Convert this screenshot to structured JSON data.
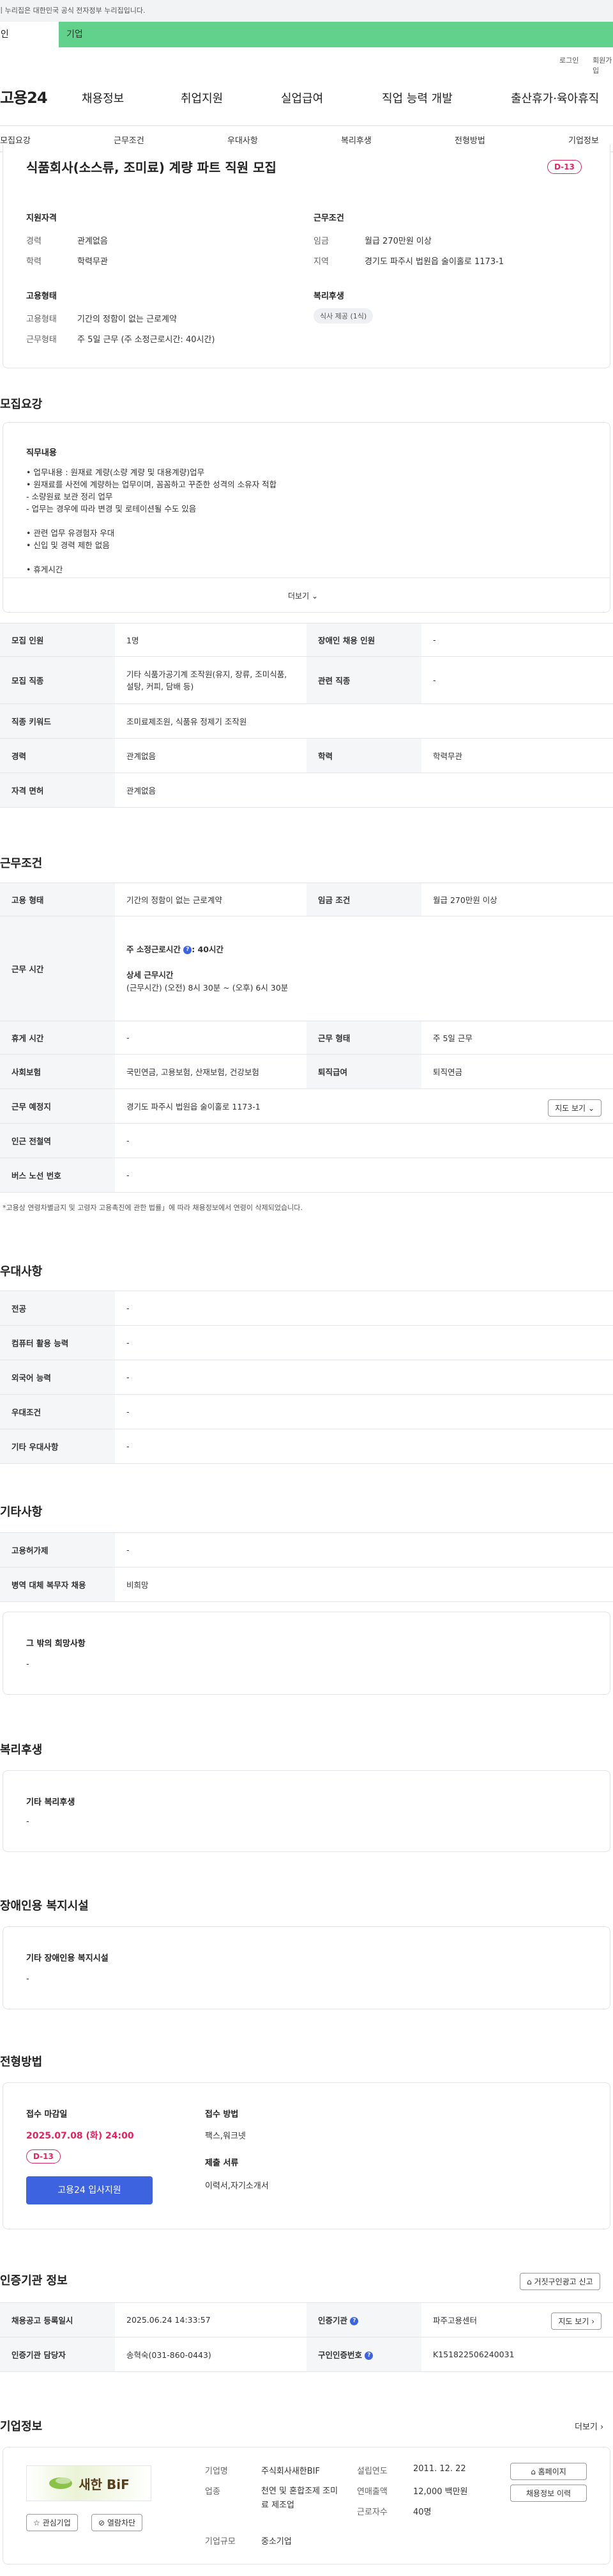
{
  "gov_banner": "이 누리집은 대한민국 공식 전자정부 누리집입니다.",
  "tabs": [
    "개인",
    "기업"
  ],
  "util_links": [
    "로그인",
    "회원가입"
  ],
  "brand": "고용24",
  "gnb": [
    "채용정보",
    "취업지원",
    "실업급여",
    "직업 능력 개발",
    "출산휴가·육아휴직"
  ],
  "subnav": [
    "모집요강",
    "근무조건",
    "우대사항",
    "복리후생",
    "전형방법",
    "기업정보"
  ],
  "job": {
    "title": "식품회사(소스류, 조미료) 계량 파트 직원 모집",
    "dday": "D-13",
    "qualification_h": "지원자격",
    "career_l": "경력",
    "career_v": "관계없음",
    "edu_l": "학력",
    "edu_v": "학력무관",
    "conditions_h": "근무조건",
    "wage_l": "임금",
    "wage_v": "월급 270만원 이상",
    "region_l": "지역",
    "region_v": "경기도 파주시 법원읍 술이홀로 1173-1",
    "employ_h": "고용형태",
    "emptype_l": "고용형태",
    "emptype_v": "기간의 정함이 없는 근로계약",
    "worktype_l": "근무형태",
    "worktype_v": "주 5일 근무 (주 소정근로시간: 40시간)",
    "welfare_h": "복리후생",
    "welfare_pill": "식사 제공 (1식)"
  },
  "recruit": {
    "title": "모집요강",
    "duty_h": "직무내용",
    "duty_lines": [
      "• 업무내용 : 원재료 계량(소량 계량 및 대용계량)업무",
      "• 원재료를 사전에 계량하는 업무이며, 꼼꼼하고 꾸준한 성격의 소유자 적합",
      "- 소량원료 보관 정리 업무",
      "- 업무는 경우에 따라 변경 및 로테이션될 수도 있음",
      "",
      "• 관련 업무 유경험자 우대",
      "• 신입 및 경력 제한 없음",
      "",
      "• 휴게시간"
    ],
    "more": "더보기",
    "rows": [
      [
        "모집 인원",
        "1명",
        "장애인 채용 인원",
        "-"
      ],
      [
        "모집 직종",
        "기타 식품가공기계 조작원(유지, 장류, 조미식품, 설탕, 커피, 담배 등)",
        "관련 직종",
        "-"
      ],
      [
        "직종 키워드",
        "조미료제조원, 식품유 정제기 조작원",
        "",
        ""
      ],
      [
        "경력",
        "관계없음",
        "학력",
        "학력무관"
      ],
      [
        "자격 면허",
        "관계없음",
        "",
        ""
      ]
    ]
  },
  "conditions": {
    "title": "근무조건",
    "emptype_l": "고용 형태",
    "emptype_v": "기간의 정함이 없는 근로계약",
    "wage_l": "임금 조건",
    "wage_v": "월급 270만원 이상",
    "hours_l": "근무 시간",
    "hours_week_l": "주 소정근로시간",
    "hours_week_v": ": 40시간",
    "hours_detail_l": "상세 근무시간",
    "hours_detail_v": "(근무시간) (오전) 8시 30분 ~ (오후) 6시 30분",
    "rest_l": "휴게 시간",
    "rest_v": "-",
    "worktype_l": "근무 형태",
    "worktype_v": "주 5일 근무",
    "insurance_l": "사회보험",
    "insurance_v": "국민연금, 고용보험, 산재보험, 건강보험",
    "retire_l": "퇴직급여",
    "retire_v": "퇴직연금",
    "place_l": "근무 예정지",
    "place_v": "경기도 파주시 법원읍 술이홀로 1173-1",
    "map_btn": "지도 보기",
    "subway_l": "인근 전철역",
    "subway_v": "-",
    "bus_l": "버스 노선 번호",
    "bus_v": "-",
    "note": "*고용상 연령차별금지 및 고령자 고용촉진에 관한 법률」에 따라 채용정보에서 연령이 삭제되었습니다."
  },
  "preference": {
    "title": "우대사항",
    "rows": [
      [
        "전공",
        "-"
      ],
      [
        "컴퓨터 활용 능력",
        "-"
      ],
      [
        "외국어 능력",
        "-"
      ],
      [
        "우대조건",
        "-"
      ],
      [
        "기타 우대사항",
        "-"
      ]
    ]
  },
  "etc": {
    "title": "기타사항",
    "rows": [
      [
        "고용허가제",
        "-"
      ],
      [
        "병역 대체 복무자 채용",
        "비희망"
      ]
    ],
    "other_h": "그 밖의 희망사항",
    "other_v": "-"
  },
  "welfare": {
    "title": "복리후생",
    "h": "기타 복리후생",
    "v": "-"
  },
  "disabled": {
    "title": "장애인용 복지시설",
    "h": "기타 장애인용 복지시설",
    "v": "-"
  },
  "selection": {
    "title": "전형방법",
    "deadline_h": "접수 마감일",
    "deadline_v": "2025.07.08 (화) 24:00",
    "dday": "D-13",
    "apply_btn": "고용24 입사지원",
    "method_h": "접수 방법",
    "method_v": "팩스,워크넷",
    "docs_h": "제출 서류",
    "docs_v": "이력서,자기소개서"
  },
  "cert": {
    "title": "인증기관 정보",
    "report_btn": "거짓구인광고 신고",
    "rows": [
      [
        "채용공고 등록일시",
        "2025.06.24 14:33:57",
        "인증기관",
        "파주고용센터"
      ],
      [
        "인증기관 담당자",
        "송혁숙(031-860-0443)",
        "구인인증번호",
        "K151822506240031"
      ]
    ],
    "map_btn": "지도 보기"
  },
  "company": {
    "title": "기업정보",
    "more": "더보기",
    "logo_text": "새한 BiF",
    "interest_btn": "관심기업",
    "block_btn": "열람차단",
    "name_l": "기업명",
    "name_v": "주식회사새한BIF",
    "industry_l": "업종",
    "industry_v": "천연 및 혼합조제 조미료 제조업",
    "scale_l": "기업규모",
    "scale_v": "중소기업",
    "founded_l": "설립연도",
    "founded_v": "2011. 12. 22",
    "sales_l": "연매출액",
    "sales_v": "12,000 백만원",
    "employees_l": "근로자수",
    "employees_v": "40명",
    "homepage_btn": "홈페이지",
    "history_btn": "채용정보 이력"
  },
  "colors": {
    "accent": "#3d63e0",
    "dday": "#e0245e",
    "corp_tab": "#62d18b"
  }
}
